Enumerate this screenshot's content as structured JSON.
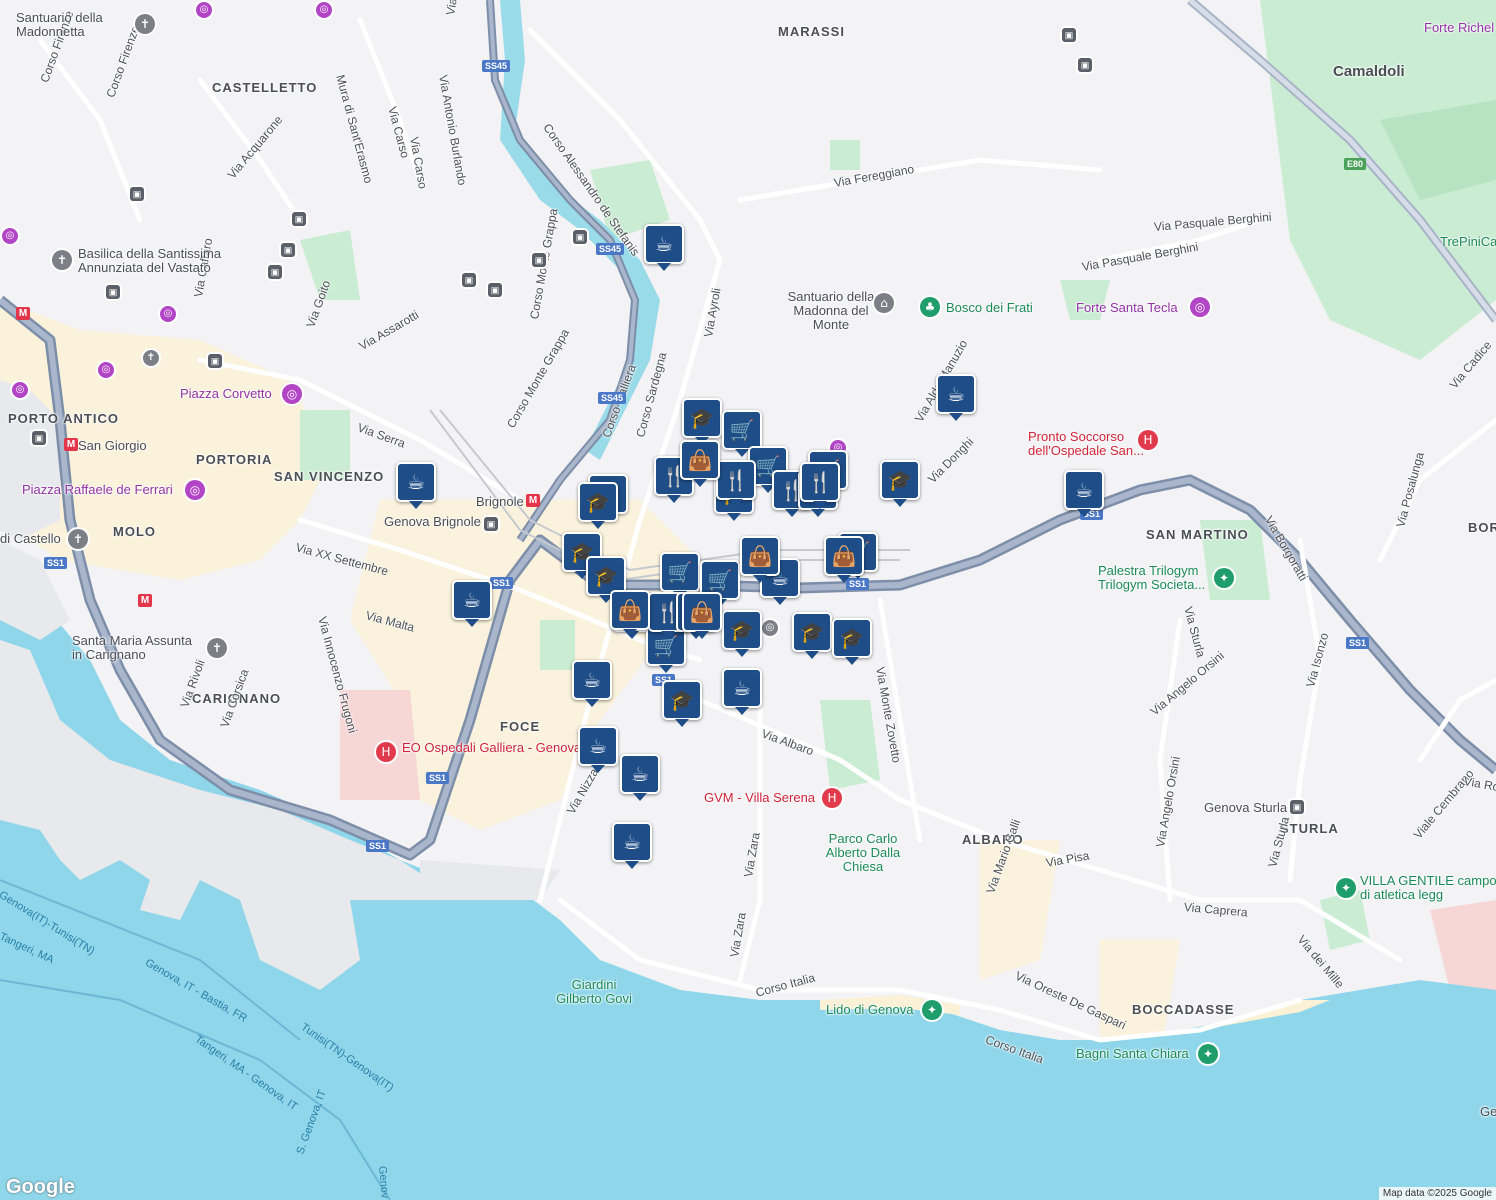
{
  "map": {
    "attribution": "Map data ©2025 Google",
    "logo": "Google",
    "colors": {
      "sea": "#8fd6ea",
      "land": "#f3f3f5",
      "park": "#c9ecd2",
      "urban": "#fbf1d6",
      "highway": "#8a9bb5",
      "pin": "#1e4d87"
    }
  },
  "districts": [
    "MARASSI",
    "CASTELLETTO",
    "PORTO ANTICO",
    "PORTORIA",
    "SAN VINCENZO",
    "MOLO",
    "CARIGNANO",
    "FOCE",
    "ALBARO",
    "STURLA",
    "BOCCADASSE",
    "SAN MARTINO",
    "BORGOR",
    "Camaldoli"
  ],
  "streets": [
    "Corso Firenze",
    "Corso Firenze",
    "Mura di Sant'Erasmo",
    "Via Carso",
    "Via Antonio Burlando",
    "Via Leonardo Montaldo",
    "Corso Alessandro de Stefanis",
    "Via Acquarone",
    "Via Caffaro",
    "Via Goito",
    "Via Assarotti",
    "Corso Monte Grappa",
    "Corso Monte Grappa",
    "Corso Galliera",
    "Corso Sardegna",
    "Via Ayroli",
    "Via Fereggiano",
    "Via Pasquale Berghini",
    "Via Pasquale Berghini",
    "Via Serra",
    "Via XX Settembre",
    "Via Malta",
    "Via Innocenzo Frugoni",
    "Via Rivoli",
    "Via Corsica",
    "Via Albaro",
    "Via Monte Zovetto",
    "Via Nizza",
    "Via Zara",
    "Via Zara",
    "Corso Italia",
    "Corso Italia",
    "Via Pisa",
    "Via Mario Galli",
    "Via Oreste De Gaspari",
    "Via Caprera",
    "Via Angelo Orsini",
    "Via Angelo Orsini",
    "Via Sturla",
    "Via Sturla",
    "Via Isonzo",
    "Via Borgoratti",
    "Via Posalunga",
    "Viale Cembrano",
    "Via dei Mille",
    "Via Aldo Manuzio",
    "Via Donghi",
    "Via Carso",
    "Via Cadice",
    "Via Ro"
  ],
  "pois": {
    "santuario_madonnetta": "Santuario della Madonnetta",
    "basilica": "Basilica della Santissima Annunziata del Vastato",
    "piazza_corvetto": "Piazza Corvetto",
    "san_giorgio": "San Giorgio",
    "piazza_ferrari": "Piazza Raffaele de Ferrari",
    "castello": "di Castello",
    "genova_brignole": "Genova Brignole",
    "brignole": "Brignole",
    "santa_maria": "Santa Maria Assunta in Carignano",
    "eo_ospedali": "EO Ospedali Galliera - Genova",
    "santuario_monte": "Santuario della Madonna del Monte",
    "bosco_frati": "Bosco dei Frati",
    "forte_santa_tecla": "Forte Santa Tecla",
    "forte_richel": "Forte Richel",
    "pronto_soccorso": "Pronto Soccorso dell'Ospedale San...",
    "palestra": "Palestra Trilogym Trilogym Societa...",
    "gvm": "GVM - Villa Serena",
    "parco": "Parco Carlo Alberto Dalla Chiesa",
    "genova_sturla": "Genova Sturla",
    "villa_gentile": "VILLA GENTILE campo di atletica legg",
    "lido": "Lido di Genova",
    "bagni": "Bagni Santa Chiara",
    "giardini": "Giardini Gilberto Govi",
    "trepinica": "TrePiniCa",
    "ge": "Ge"
  },
  "ferry_routes": [
    "Genova(IT)-Tunisi(TN)",
    "Tangeri, MA",
    "Genova, IT - Bastia, FR",
    "Tangeri, MA - Genova, IT",
    "Tunisi(TN)-Genova(IT)",
    "S. Genova, IT",
    "Genov"
  ],
  "road_shields": [
    "SS45",
    "SS45",
    "SS45",
    "SS1",
    "SS1",
    "SS1",
    "SS1",
    "SS1",
    "SS1",
    "SS1",
    "SS1",
    "E80"
  ],
  "markers": [
    "cafe",
    "cafe",
    "cafe",
    "cafe",
    "cafe",
    "cafe",
    "cafe",
    "cafe",
    "cafe",
    "cafe",
    "cafe",
    "cafe",
    "school",
    "school",
    "school",
    "school",
    "school",
    "school",
    "school",
    "school",
    "school",
    "school",
    "school",
    "shop",
    "shop",
    "shop",
    "shop",
    "shop",
    "shop",
    "shop",
    "restaurant",
    "restaurant",
    "restaurant",
    "restaurant",
    "restaurant",
    "restaurant",
    "restaurant",
    "bag",
    "bag",
    "bag",
    "bag",
    "bag"
  ]
}
